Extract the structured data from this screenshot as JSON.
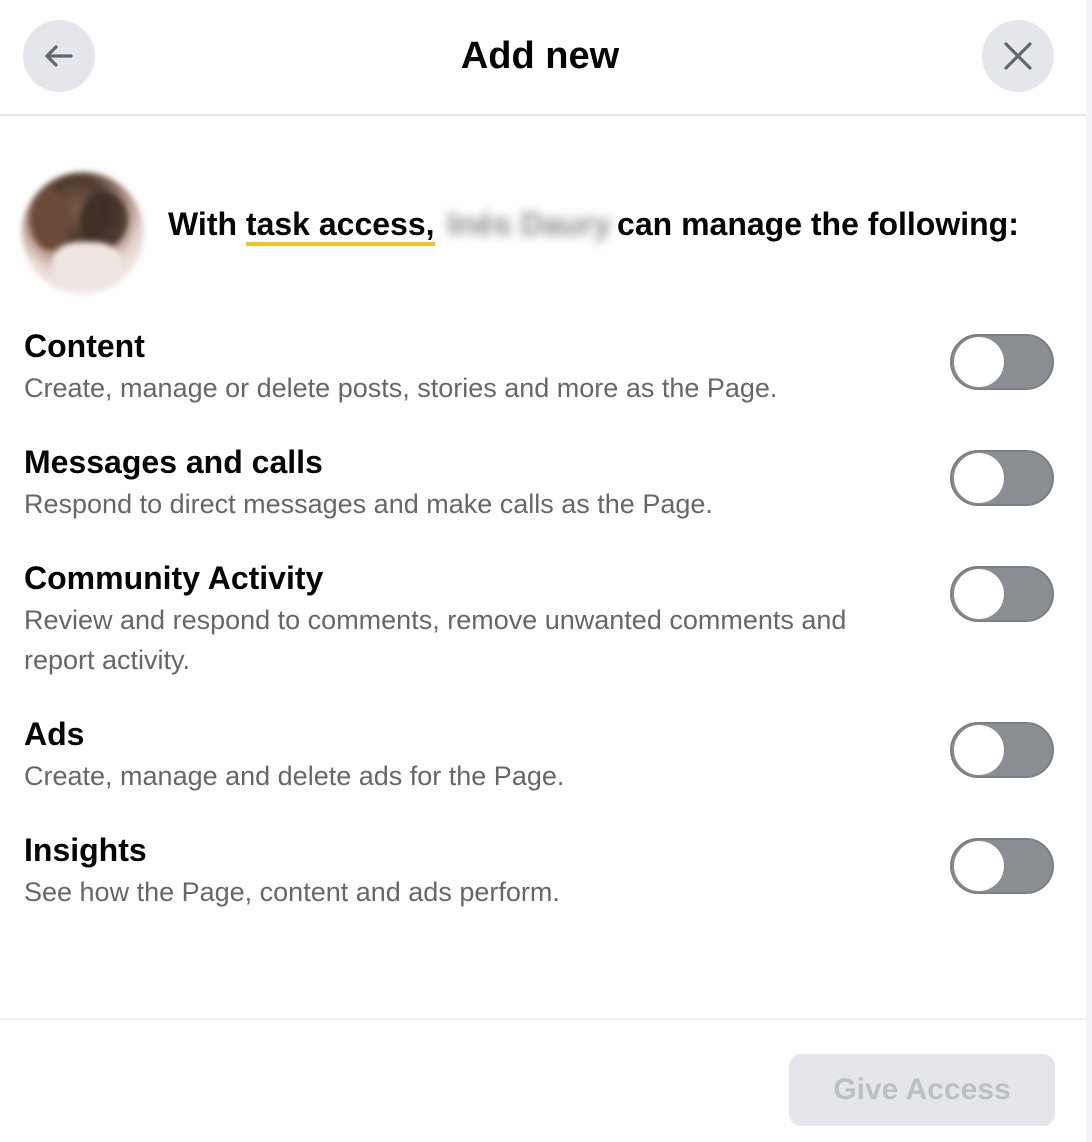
{
  "header": {
    "title": "Add new",
    "back_icon": "arrow-left-icon",
    "close_icon": "close-icon"
  },
  "intro": {
    "prefix": "With",
    "link": "task access,",
    "name": "Inés Daury",
    "suffix": "can manage the following:"
  },
  "permissions": [
    {
      "title": "Content",
      "description": "Create, manage or delete posts, stories and more as the Page.",
      "enabled": false
    },
    {
      "title": "Messages and calls",
      "description": "Respond to direct messages and make calls as the Page.",
      "enabled": false
    },
    {
      "title": "Community Activity",
      "description": "Review and respond to comments, remove unwanted comments and report activity.",
      "enabled": false
    },
    {
      "title": "Ads",
      "description": "Create, manage and delete ads for the Page.",
      "enabled": false
    },
    {
      "title": "Insights",
      "description": "See how the Page, content and ads perform.",
      "enabled": false
    }
  ],
  "footer": {
    "give_access_label": "Give Access",
    "give_access_disabled": true
  },
  "colors": {
    "underline_accent": "#f2c12e",
    "toggle_off": "#8a8d91",
    "button_disabled_bg": "#e4e6eb",
    "button_disabled_text": "#bcc0c4",
    "secondary_text": "#65676b"
  }
}
